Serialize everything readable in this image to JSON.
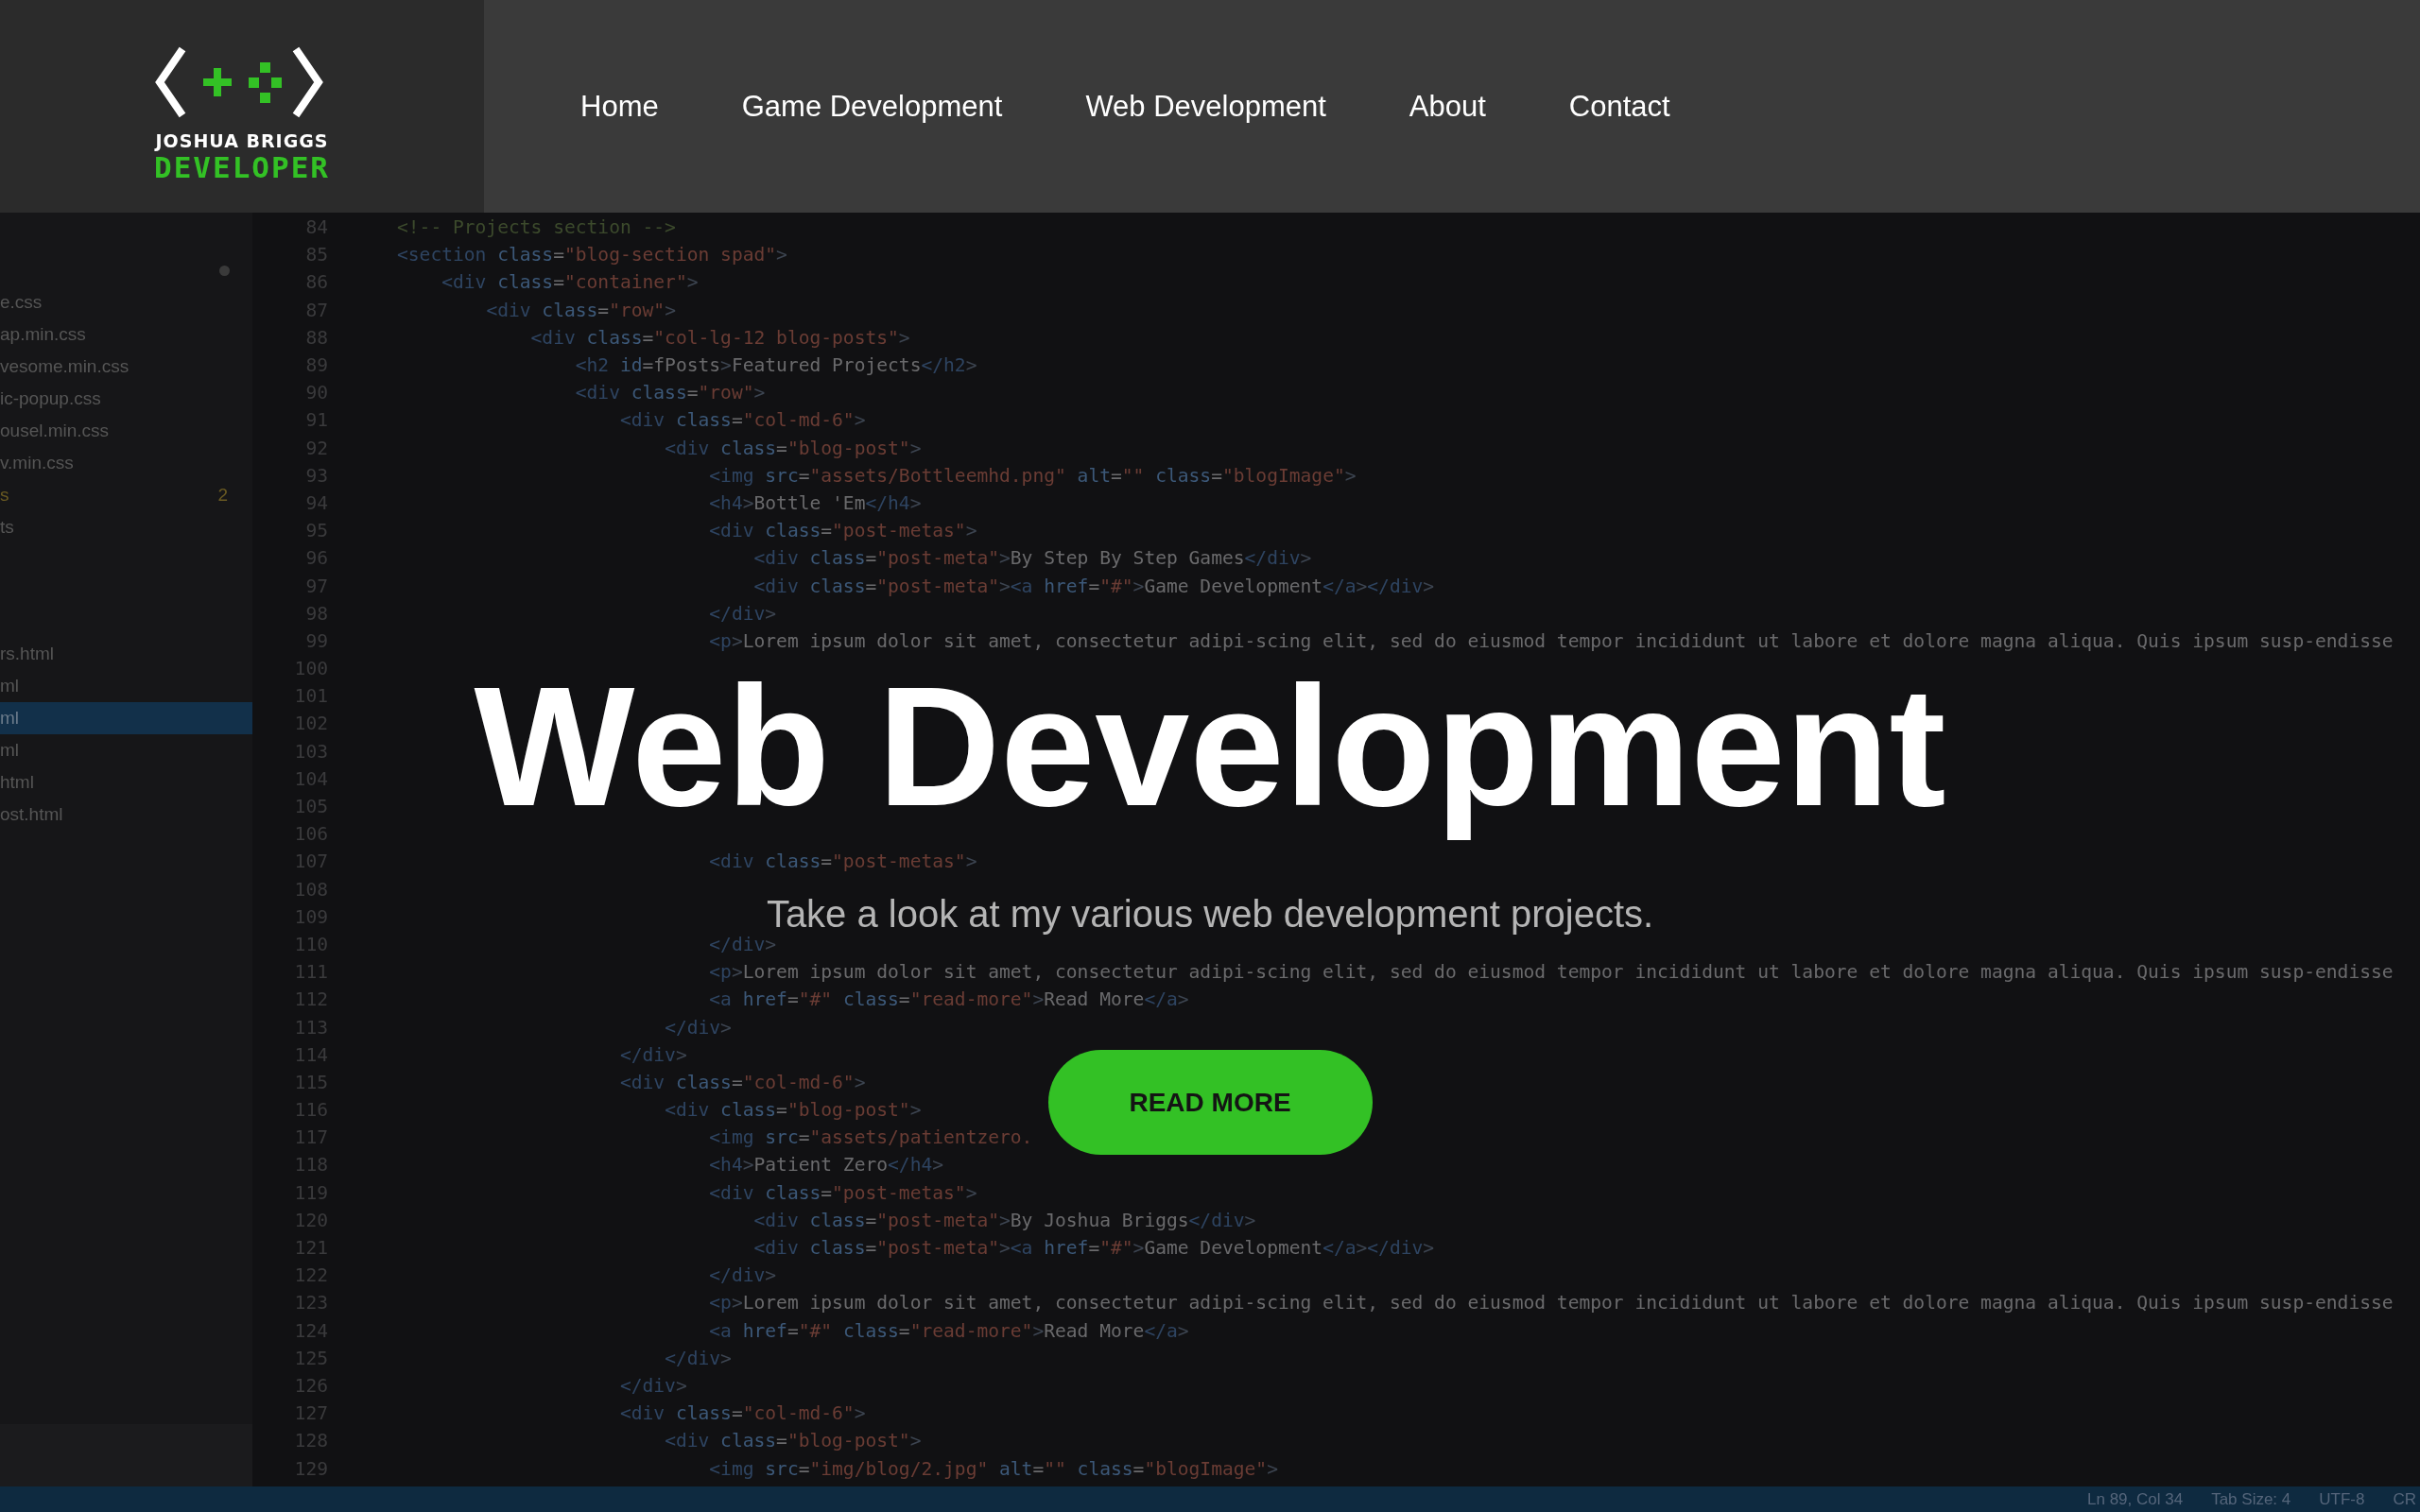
{
  "header": {
    "logo": {
      "name": "JOSHUA BRIGGS",
      "tagline": "DEVELOPER"
    },
    "nav": [
      {
        "label": "Home"
      },
      {
        "label": "Game Development"
      },
      {
        "label": "Web Development"
      },
      {
        "label": "About"
      },
      {
        "label": "Contact"
      }
    ]
  },
  "editor": {
    "sidebar": {
      "groups": [
        [
          {
            "label": "e.css",
            "kind": "file",
            "selected": false
          },
          {
            "label": "ap.min.css",
            "kind": "file",
            "selected": false
          },
          {
            "label": "vesome.min.css",
            "kind": "file",
            "selected": false
          },
          {
            "label": "ic-popup.css",
            "kind": "file",
            "selected": false
          },
          {
            "label": "ousel.min.css",
            "kind": "file",
            "selected": false
          },
          {
            "label": "v.min.css",
            "kind": "file",
            "selected": false
          },
          {
            "label": "s",
            "kind": "modified",
            "badge": "2",
            "selected": false
          },
          {
            "label": "ts",
            "kind": "file",
            "selected": false
          }
        ],
        [
          {
            "label": "rs.html",
            "kind": "file",
            "selected": false
          },
          {
            "label": "ml",
            "kind": "file",
            "selected": false
          },
          {
            "label": "ml",
            "kind": "file",
            "selected": true
          },
          {
            "label": "ml",
            "kind": "file",
            "selected": false
          },
          {
            "label": "html",
            "kind": "file",
            "selected": false
          },
          {
            "label": "ost.html",
            "kind": "file",
            "selected": false
          }
        ]
      ]
    },
    "lines": [
      {
        "number": "84",
        "text": "<!-- Projects section -->"
      },
      {
        "number": "85",
        "text": "<section class=\"blog-section spad\">"
      },
      {
        "number": "86",
        "text": "    <div class=\"container\">"
      },
      {
        "number": "87",
        "text": "        <div class=\"row\">"
      },
      {
        "number": "88",
        "text": "            <div class=\"col-lg-12 blog-posts\">"
      },
      {
        "number": "89",
        "text": "                <h2 id=fPosts>Featured Projects</h2>"
      },
      {
        "number": "90",
        "text": "                <div class=\"row\">"
      },
      {
        "number": "91",
        "text": "                    <div class=\"col-md-6\">"
      },
      {
        "number": "92",
        "text": "                        <div class=\"blog-post\">"
      },
      {
        "number": "93",
        "text": "                            <img src=\"assets/Bottleemhd.png\" alt=\"\" class=\"blogImage\">"
      },
      {
        "number": "94",
        "text": "                            <h4>Bottle 'Em</h4>"
      },
      {
        "number": "95",
        "text": "                            <div class=\"post-metas\">"
      },
      {
        "number": "96",
        "text": "                                <div class=\"post-meta\">By Step By Step Games</div>"
      },
      {
        "number": "97",
        "text": "                                <div class=\"post-meta\"><a href=\"#\">Game Development</a></div>"
      },
      {
        "number": "98",
        "text": "                            </div>"
      },
      {
        "number": "99",
        "text": "                            <p>Lorem ipsum dolor sit amet, consectetur adipi-scing elit, sed do eiusmod tempor incididunt ut labore et dolore magna aliqua. Quis ipsum susp-endisse"
      },
      {
        "number": "100"
      },
      {
        "number": "101"
      },
      {
        "number": "102"
      },
      {
        "number": "103"
      },
      {
        "number": "104"
      },
      {
        "number": "105"
      },
      {
        "number": "106"
      },
      {
        "number": "107",
        "text": "                            <div class=\"post-metas\">"
      },
      {
        "number": "108"
      },
      {
        "number": "109"
      },
      {
        "number": "110",
        "text": "                            </div>"
      },
      {
        "number": "111",
        "text": "                            <p>Lorem ipsum dolor sit amet, consectetur adipi-scing elit, sed do eiusmod tempor incididunt ut labore et dolore magna aliqua. Quis ipsum susp-endisse"
      },
      {
        "number": "112",
        "text": "                            <a href=\"#\" class=\"read-more\">Read More</a>"
      },
      {
        "number": "113",
        "text": "                        </div>"
      },
      {
        "number": "114",
        "text": "                    </div>"
      },
      {
        "number": "115",
        "text": "                    <div class=\"col-md-6\">"
      },
      {
        "number": "116",
        "text": "                        <div class=\"blog-post\">"
      },
      {
        "number": "117",
        "text": "                            <img src=\"assets/patientzero."
      },
      {
        "number": "118",
        "text": "                            <h4>Patient Zero</h4>"
      },
      {
        "number": "119",
        "text": "                            <div class=\"post-metas\">"
      },
      {
        "number": "120",
        "text": "                                <div class=\"post-meta\">By Joshua Briggs</div>"
      },
      {
        "number": "121",
        "text": "                                <div class=\"post-meta\"><a href=\"#\">Game Development</a></div>"
      },
      {
        "number": "122",
        "text": "                            </div>"
      },
      {
        "number": "123",
        "text": "                            <p>Lorem ipsum dolor sit amet, consectetur adipi-scing elit, sed do eiusmod tempor incididunt ut labore et dolore magna aliqua. Quis ipsum susp-endisse"
      },
      {
        "number": "124",
        "text": "                            <a href=\"#\" class=\"read-more\">Read More</a>"
      },
      {
        "number": "125",
        "text": "                        </div>"
      },
      {
        "number": "126",
        "text": "                    </div>"
      },
      {
        "number": "127",
        "text": "                    <div class=\"col-md-6\">"
      },
      {
        "number": "128",
        "text": "                        <div class=\"blog-post\">"
      },
      {
        "number": "129",
        "text": "                            <img src=\"img/blog/2.jpg\" alt=\"\" class=\"blogImage\">"
      }
    ],
    "status_bar": [
      "Ln 89, Col 34",
      "Tab Size: 4",
      "UTF-8",
      "CR"
    ]
  },
  "hero": {
    "title": "Web Development",
    "subtitle": "Take a look at my various web development projects.",
    "button": "READ MORE"
  }
}
